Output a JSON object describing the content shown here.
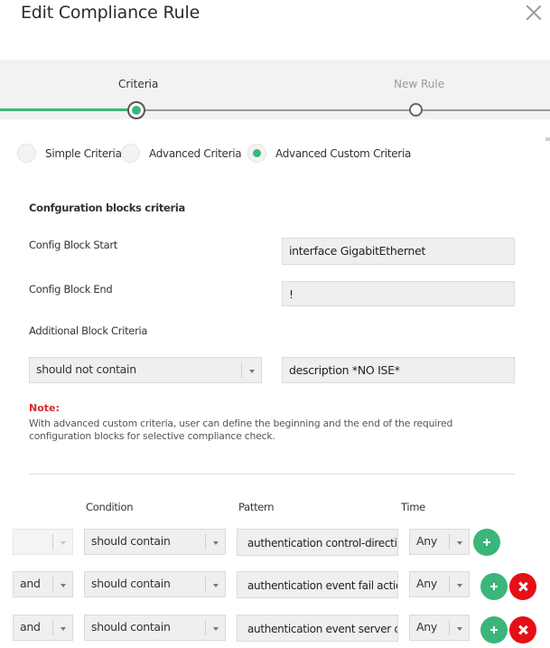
{
  "dialog": {
    "title": "Edit Compliance Rule",
    "close_icon": "close-icon"
  },
  "wizard": {
    "steps": [
      {
        "label": "Criteria",
        "state": "active"
      },
      {
        "label": "New Rule",
        "state": "upcoming"
      }
    ],
    "accent_color": "#3bb57a"
  },
  "criteria_type": {
    "options": [
      {
        "label": "Simple Criteria",
        "selected": false
      },
      {
        "label": "Advanced Criteria",
        "selected": false
      },
      {
        "label": "Advanced Custom Criteria",
        "selected": true
      }
    ]
  },
  "block_criteria": {
    "heading": "Confguration blocks criteria",
    "start_label": "Config Block Start",
    "start_value": "interface GigabitEthernet",
    "end_label": "Config Block End",
    "end_value": "!",
    "additional_label": "Additional Block Criteria",
    "additional_condition": "should not contain",
    "additional_value": "description *NO ISE*"
  },
  "note": {
    "title": "Note:",
    "text": "With advanced custom criteria, user can define the beginning and the end of the required configuration blocks for selective compliance check."
  },
  "rules_table": {
    "headers": {
      "condition": "Condition",
      "pattern": "Pattern",
      "time": "Time"
    },
    "rows": [
      {
        "operator": "",
        "condition": "should contain",
        "pattern": "authentication control-direction",
        "time": "Any"
      },
      {
        "operator": "and",
        "condition": "should contain",
        "pattern": "authentication event fail action",
        "time": "Any"
      },
      {
        "operator": "and",
        "condition": "should contain",
        "pattern": "authentication event server de",
        "time": "Any"
      }
    ]
  },
  "colors": {
    "add_button": "#3bb57a",
    "delete_button": "#e60f16",
    "note_title": "#d62b2b"
  }
}
